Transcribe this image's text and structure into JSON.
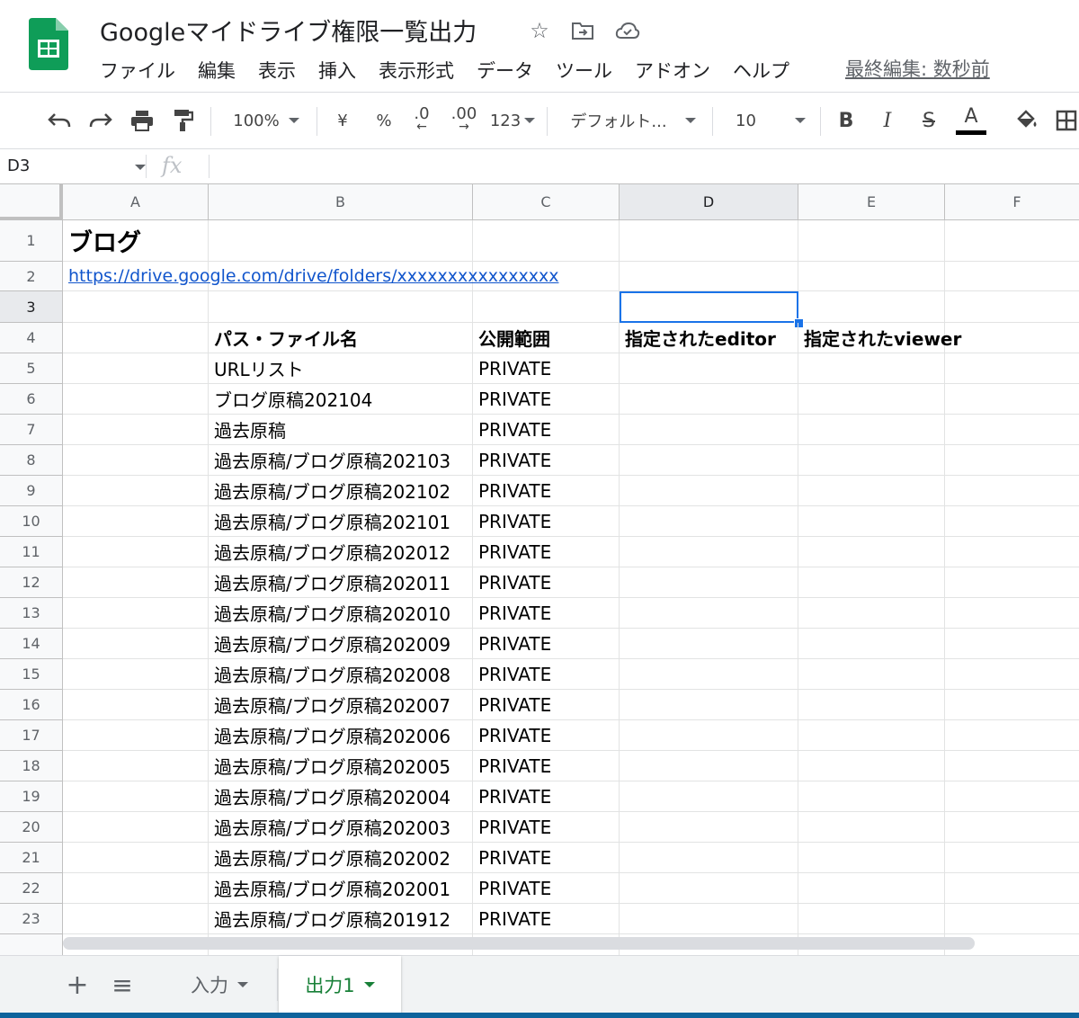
{
  "doc": {
    "title": "Googleマイドライブ権限一覧出力",
    "last_edit": "最終編集: 数秒前"
  },
  "menu": [
    "ファイル",
    "編集",
    "表示",
    "挿入",
    "表示形式",
    "データ",
    "ツール",
    "アドオン",
    "ヘルプ"
  ],
  "toolbar": {
    "zoom": "100%",
    "currency": "¥",
    "percent": "%",
    "decrease_decimal": ".0",
    "increase_decimal": ".00",
    "more_formats": "123",
    "font": "デフォルト...",
    "font_size": "10",
    "bold": "B",
    "italic": "I",
    "strike": "S",
    "text_color": "A",
    "text_color_value": "#000000"
  },
  "formula_bar": {
    "cell_ref": "D3",
    "fx": "fx",
    "value": ""
  },
  "columns": [
    "A",
    "B",
    "C",
    "D",
    "E",
    "F"
  ],
  "selected_cell": "D3",
  "sheet": {
    "a1": "ブログ",
    "a2": "https://drive.google.com/drive/folders/xxxxxxxxxxxxxxxx",
    "headers": [
      "パス・ファイル名",
      "公開範囲",
      "指定されたeditor",
      "指定されたviewer"
    ],
    "rows": [
      [
        "URLリスト",
        "PRIVATE"
      ],
      [
        "ブログ原稿202104",
        "PRIVATE"
      ],
      [
        "過去原稿",
        "PRIVATE"
      ],
      [
        "過去原稿/ブログ原稿202103",
        "PRIVATE"
      ],
      [
        "過去原稿/ブログ原稿202102",
        "PRIVATE"
      ],
      [
        "過去原稿/ブログ原稿202101",
        "PRIVATE"
      ],
      [
        "過去原稿/ブログ原稿202012",
        "PRIVATE"
      ],
      [
        "過去原稿/ブログ原稿202011",
        "PRIVATE"
      ],
      [
        "過去原稿/ブログ原稿202010",
        "PRIVATE"
      ],
      [
        "過去原稿/ブログ原稿202009",
        "PRIVATE"
      ],
      [
        "過去原稿/ブログ原稿202008",
        "PRIVATE"
      ],
      [
        "過去原稿/ブログ原稿202007",
        "PRIVATE"
      ],
      [
        "過去原稿/ブログ原稿202006",
        "PRIVATE"
      ],
      [
        "過去原稿/ブログ原稿202005",
        "PRIVATE"
      ],
      [
        "過去原稿/ブログ原稿202004",
        "PRIVATE"
      ],
      [
        "過去原稿/ブログ原稿202003",
        "PRIVATE"
      ],
      [
        "過去原稿/ブログ原稿202002",
        "PRIVATE"
      ],
      [
        "過去原稿/ブログ原稿202001",
        "PRIVATE"
      ],
      [
        "過去原稿/ブログ原稿201912",
        "PRIVATE"
      ]
    ]
  },
  "tabs": {
    "add": "+",
    "list": "≡",
    "items": [
      {
        "label": "入力",
        "active": false
      },
      {
        "label": "出力1",
        "active": true
      }
    ]
  },
  "colors": {
    "sheets_green": "#0f9d58",
    "active_tab": "#188038",
    "selection": "#1a73e8",
    "link": "#1155cc"
  }
}
